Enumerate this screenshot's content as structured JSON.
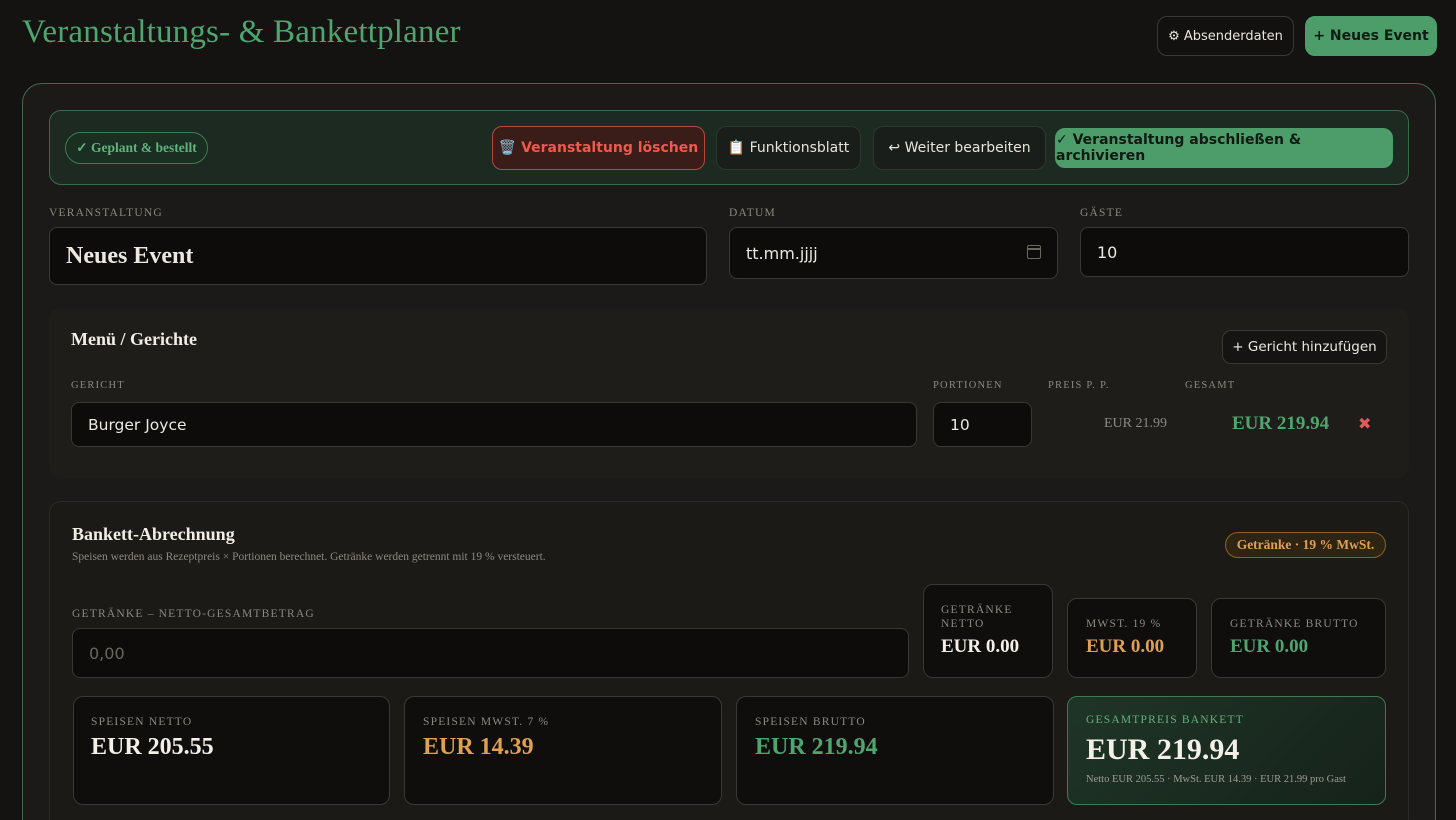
{
  "header": {
    "title": "Veranstaltungs- & Bankettplaner",
    "sender_button": "⚙ Absenderdaten",
    "new_event_button": "+ Neues Event"
  },
  "status": {
    "badge": "✓ Geplant & bestellt",
    "delete_button": "🗑️ Veranstaltung löschen",
    "function_sheet_button": "📋 Funktionsblatt",
    "edit_button": "↩ Weiter bearbeiten",
    "archive_button": "✓ Veranstaltung abschließen & archivieren"
  },
  "event": {
    "name_label": "Veranstaltung",
    "name_value": "Neues Event",
    "date_label": "Datum",
    "date_value": "tt.mm.jjjj",
    "guests_label": "Gäste",
    "guests_value": "10"
  },
  "menu": {
    "title": "Menü / Gerichte",
    "add_button": "+ Gericht hinzufügen",
    "columns": {
      "dish": "Gericht",
      "portions": "Portionen",
      "price": "Preis p. P.",
      "total": "Gesamt"
    },
    "items": [
      {
        "name": "Burger Joyce",
        "portions": "10",
        "price": "EUR 21.99",
        "total": "EUR 219.94",
        "remove": "✖"
      }
    ]
  },
  "billing": {
    "title": "Bankett-Abrechnung",
    "subtitle": "Speisen werden aus Rezeptpreis × Portionen berechnet. Getränke werden getrennt mit 19 % versteuert.",
    "tax_badge": "Getränke · 19 % MwSt.",
    "drinks_label": "Getränke – Netto-Gesamtbetrag",
    "drinks_placeholder": "0,00",
    "drinks_net_label": "Getränke Netto",
    "drinks_net_value": "EUR 0.00",
    "vat19_label": "MwSt. 19 %",
    "vat19_value": "EUR 0.00",
    "drinks_gross_label": "Getränke Brutto",
    "drinks_gross_value": "EUR 0.00",
    "food_net_label": "Speisen Netto",
    "food_net_value": "EUR 205.55",
    "food_vat_label": "Speisen MwSt. 7 %",
    "food_vat_value": "EUR 14.39",
    "food_gross_label": "Speisen Brutto",
    "food_gross_value": "EUR 219.94",
    "total_label": "Gesamtpreis Bankett",
    "total_value": "EUR 219.94",
    "total_breakdown": "Netto EUR 205.55 · MwSt. EUR 14.39 · EUR 21.99 pro Gast"
  },
  "colors": {
    "accent_green": "#4fa56f",
    "danger_red": "#ee5a4b",
    "accent_orange": "#e0a050",
    "background": "#141312"
  }
}
